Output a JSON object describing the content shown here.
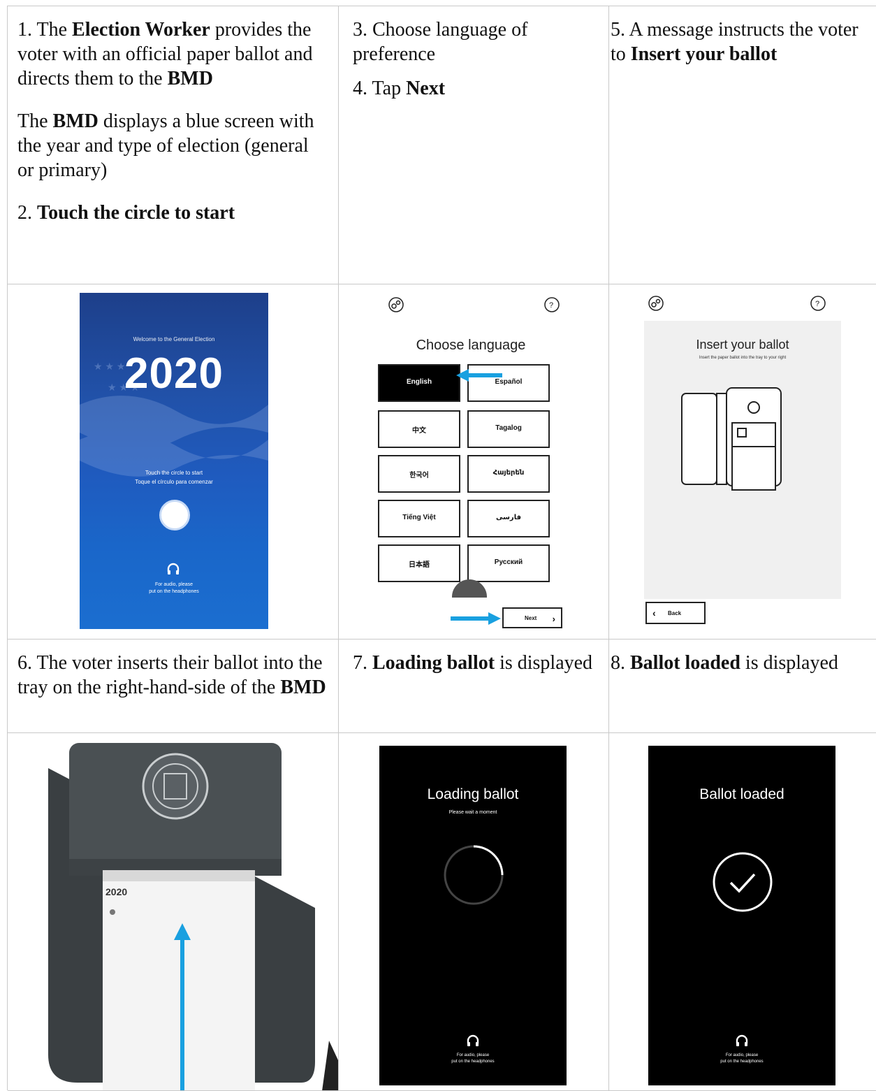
{
  "step1": {
    "line1_pre": "1. The ",
    "line1_bold": "Election Worker",
    "line1_post": " provides the voter with an official paper ballot and directs them to the ",
    "line1_bold2": "BMD",
    "line2_pre": "The ",
    "line2_bold": "BMD",
    "line2_post": " displays a blue screen with the year and type of election (general or primary)",
    "line3_pre": "2. ",
    "line3_bold": "Touch the circle to start"
  },
  "step3": {
    "line1": "3. Choose language of preference",
    "line2_pre": "4. Tap ",
    "line2_bold": "Next"
  },
  "step5": {
    "pre": "5. A message instructs the voter to ",
    "bold": "Insert your ballot"
  },
  "screen1": {
    "welcome": "Welcome to the General Election",
    "year": "2020",
    "touch_en": "Touch the circle to start",
    "touch_es": "Toque el círculo para comenzar",
    "audio1": "For audio, please",
    "audio2": "put on the headphones"
  },
  "screen2": {
    "title": "Choose language",
    "languages": [
      "English",
      "Español",
      "中文",
      "Tagalog",
      "한국어",
      "Հայերեն",
      "Tiếng Việt",
      "فارسی",
      "日本語",
      "Русский"
    ],
    "next": "Next"
  },
  "screen3": {
    "title": "Insert your ballot",
    "subtitle": "Insert the paper ballot into the tray to your right",
    "back": "Back"
  },
  "step6": {
    "pre": "6. The voter inserts their ballot into the tray on the right-hand-side of the ",
    "bold": "BMD"
  },
  "step7": {
    "pre": "7. ",
    "bold": "Loading ballot",
    "post": " is displayed"
  },
  "step8": {
    "pre": "8. ",
    "bold": "Ballot loaded",
    "post": " is displayed"
  },
  "photo": {
    "paper_year": "2020"
  },
  "screen7": {
    "title": "Loading ballot",
    "subtitle": "Please wait a moment",
    "audio1": "For audio, please",
    "audio2": "put on the headphones"
  },
  "screen8": {
    "title": "Ballot loaded",
    "audio1": "For audio, please",
    "audio2": "put on the headphones"
  },
  "colors": {
    "screen_blue": "#1f5bbf",
    "arrow_blue": "#19a0e0",
    "screen_black": "#000000"
  }
}
